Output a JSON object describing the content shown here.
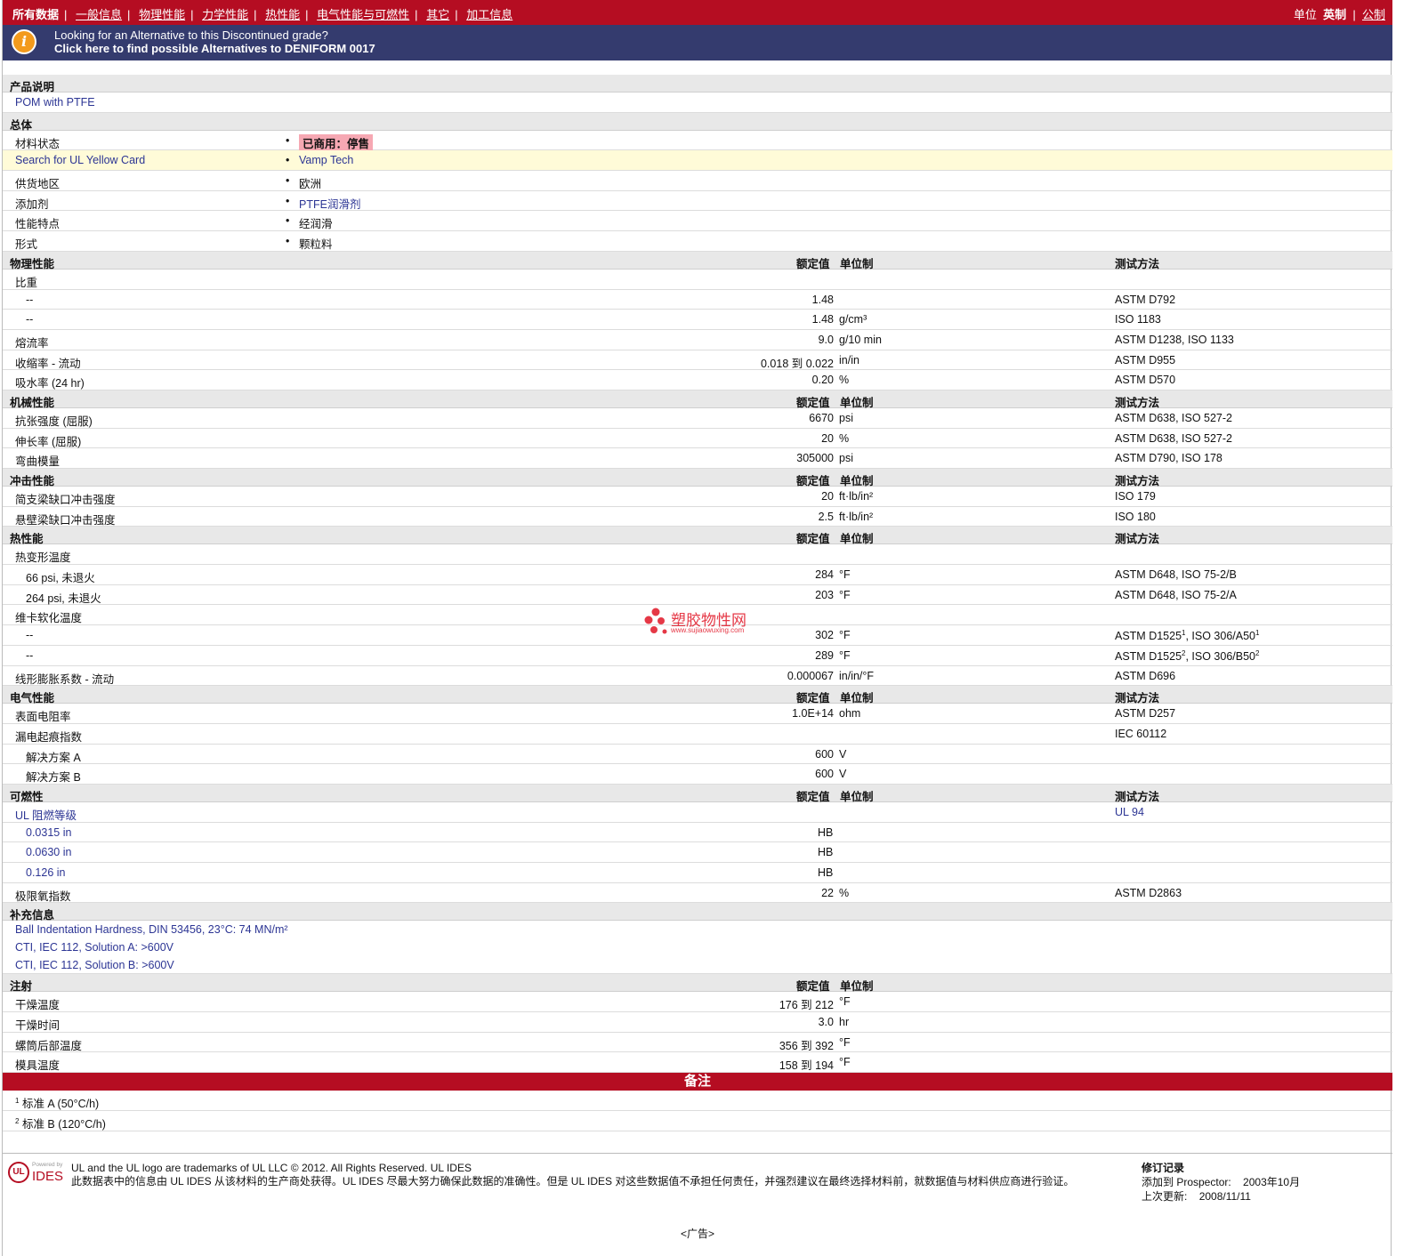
{
  "nav": {
    "links": [
      "所有数据",
      "一般信息",
      "物理性能",
      "力学性能",
      "热性能",
      "电气性能与可燃性",
      "其它",
      "加工信息"
    ],
    "units_label": "单位",
    "units_imperial": "英制",
    "units_metric": "公制"
  },
  "alt_banner": {
    "line1": "Looking for an Alternative to this Discontinued grade?",
    "line2": "Click here to find possible Alternatives to DENIFORM 0017"
  },
  "product": {
    "section": "产品说明",
    "description": "POM with PTFE"
  },
  "general": {
    "section": "总体",
    "rows": [
      {
        "label": "材料状态",
        "value": "已商用：停售"
      },
      {
        "label": "Search for UL Yellow Card",
        "value": "Vamp Tech"
      },
      {
        "label": "供货地区",
        "value": "欧洲"
      },
      {
        "label": "添加剂",
        "value": "PTFE润滑剂"
      },
      {
        "label": "性能特点",
        "value": "经润滑"
      },
      {
        "label": "形式",
        "value": "颗粒料"
      }
    ]
  },
  "headers": {
    "value": "额定值",
    "unit": "单位制",
    "method": "测试方法"
  },
  "physical": {
    "section": "物理性能",
    "rows": [
      {
        "label": "比重",
        "value": "",
        "unit": "",
        "method": ""
      },
      {
        "label": "--",
        "value": "1.48",
        "unit": "",
        "method": "ASTM D792"
      },
      {
        "label": "--",
        "value": "1.48",
        "unit": "g/cm³",
        "method": "ISO 1183"
      },
      {
        "label": "熔流率",
        "value": "9.0",
        "unit": "g/10 min",
        "method": "ASTM D1238, ISO 1133"
      },
      {
        "label": "收缩率 - 流动",
        "value": "0.018 到  0.022",
        "unit": "in/in",
        "method": "ASTM D955"
      },
      {
        "label": "吸水率 (24 hr)",
        "value": "0.20",
        "unit": "%",
        "method": "ASTM D570"
      }
    ]
  },
  "mechanical": {
    "section": "机械性能",
    "rows": [
      {
        "label": "抗张强度 (屈服)",
        "value": "6670",
        "unit": "psi",
        "method": "ASTM D638, ISO 527-2"
      },
      {
        "label": "伸长率 (屈服)",
        "value": "20",
        "unit": "%",
        "method": "ASTM D638, ISO 527-2"
      },
      {
        "label": "弯曲模量",
        "value": "305000",
        "unit": "psi",
        "method": "ASTM D790, ISO 178"
      }
    ]
  },
  "impact": {
    "section": "冲击性能",
    "rows": [
      {
        "label": "简支梁缺口冲击强度",
        "value": "20",
        "unit": "ft·lb/in²",
        "method": "ISO 179"
      },
      {
        "label": "悬壁梁缺口冲击强度",
        "value": "2.5",
        "unit": "ft·lb/in²",
        "method": "ISO 180"
      }
    ]
  },
  "thermal": {
    "section": "热性能",
    "rows": [
      {
        "label": "热变形温度",
        "value": "",
        "unit": "",
        "method": ""
      },
      {
        "label": "66 psi, 未退火",
        "value": "284",
        "unit": "°F",
        "method": "ASTM D648, ISO 75-2/B"
      },
      {
        "label": "264 psi, 未退火",
        "value": "203",
        "unit": "°F",
        "method": "ASTM D648, ISO 75-2/A"
      },
      {
        "label": "维卡软化温度",
        "value": "",
        "unit": "",
        "method": ""
      },
      {
        "label": "--",
        "value": "302",
        "unit": "°F",
        "method_a": "ASTM D1525",
        "sup_a": "1",
        "method_b": ", ISO 306/A50",
        "sup_b": "1"
      },
      {
        "label": "--",
        "value": "289",
        "unit": "°F",
        "method_a": "ASTM D1525",
        "sup_a": "2",
        "method_b": ", ISO 306/B50",
        "sup_b": "2"
      },
      {
        "label": "线形膨胀系数 - 流动",
        "value": "0.000067",
        "unit": "in/in/°F",
        "method": "ASTM D696"
      }
    ]
  },
  "electrical": {
    "section": "电气性能",
    "rows": [
      {
        "label": "表面电阻率",
        "value": "1.0E+14",
        "unit": "ohm",
        "method": "ASTM D257"
      },
      {
        "label": "漏电起痕指数",
        "value": "",
        "unit": "",
        "method": "IEC 60112"
      },
      {
        "label": "解决方案 A",
        "value": "600",
        "unit": "V",
        "method": ""
      },
      {
        "label": "解决方案 B",
        "value": "600",
        "unit": "V",
        "method": ""
      }
    ]
  },
  "flammability": {
    "section": "可燃性",
    "rows": [
      {
        "label": "UL 阻燃等级",
        "value": "",
        "unit": "",
        "method": "UL 94"
      },
      {
        "label": "0.0315 in",
        "value": "HB",
        "unit": "",
        "method": ""
      },
      {
        "label": "0.0630 in",
        "value": "HB",
        "unit": "",
        "method": ""
      },
      {
        "label": "0.126 in",
        "value": "HB",
        "unit": "",
        "method": ""
      },
      {
        "label": "极限氧指数",
        "value": "22",
        "unit": "%",
        "method": "ASTM D2863"
      }
    ]
  },
  "supplemental": {
    "section": "补充信息",
    "lines": [
      "Ball Indentation Hardness, DIN 53456, 23°C: 74 MN/m²",
      "CTI, IEC 112, Solution A: >600V",
      "CTI, IEC 112, Solution B: >600V"
    ]
  },
  "injection": {
    "section": "注射",
    "rows": [
      {
        "label": "干燥温度",
        "value": "176 到  212",
        "unit": "°F"
      },
      {
        "label": "干燥时间",
        "value": "3.0",
        "unit": "hr"
      },
      {
        "label": "螺筒后部温度",
        "value": "356 到  392",
        "unit": "°F"
      },
      {
        "label": "模具温度",
        "value": "158 到  194",
        "unit": "°F"
      }
    ]
  },
  "notes": {
    "title": "备注",
    "items": [
      {
        "sup": "1",
        "text": "标准 A (50°C/h)"
      },
      {
        "sup": "2",
        "text": "标准 B (120°C/h)"
      }
    ]
  },
  "watermark": {
    "cn": "塑胶物性网",
    "url": "www.sujiaowuxing.com"
  },
  "footer": {
    "logo_ul": "UL",
    "powered_by": "Powered by",
    "ides": "IDES",
    "line1": "UL and the UL logo are trademarks of UL LLC © 2012. All Rights Reserved. UL IDES",
    "line2": "此数据表中的信息由 UL IDES 从该材料的生产商处获得。UL IDES 尽最大努力确保此数据的准确性。但是 UL IDES 对这些数据值不承担任何责任，并强烈建议在最终选择材料前，就数据值与材料供应商进行验证。",
    "revision_title": "修订记录",
    "added_label": "添加到 Prospector:",
    "added_value": "2003年10月",
    "updated_label": "上次更新:",
    "updated_value": "2008/11/11"
  },
  "ad": "<广告>"
}
